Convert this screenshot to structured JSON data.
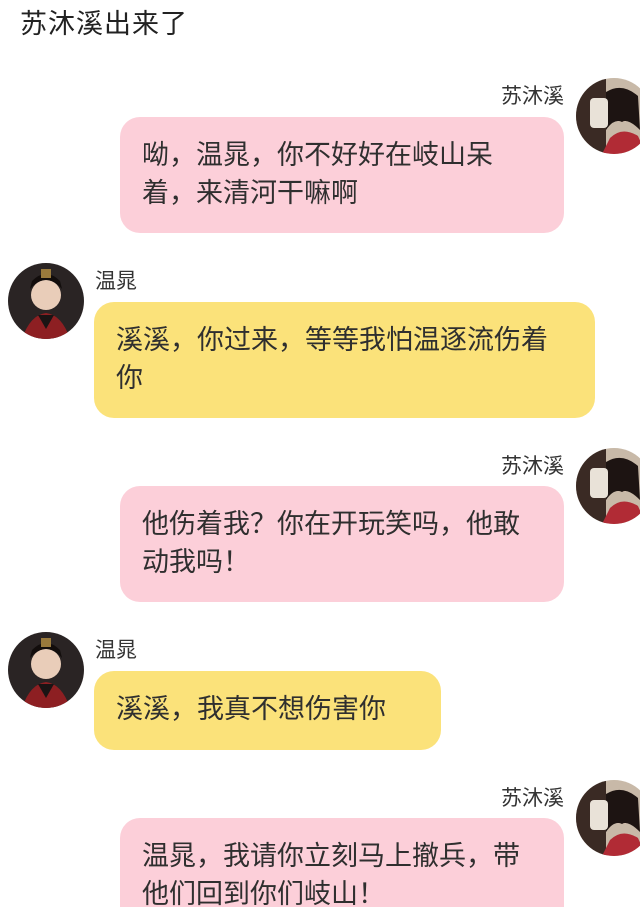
{
  "header": {
    "title": "苏沐溪出来了"
  },
  "colors": {
    "pink_bubble": "#fccfd9",
    "yellow_bubble": "#fbe27a"
  },
  "messages": [
    {
      "sender": "苏沐溪",
      "side": "right",
      "text": "呦，温晁，你不好好在岐山呆着，来清河干嘛啊"
    },
    {
      "sender": "温晁",
      "side": "left",
      "text": "溪溪，你过来，等等我怕温逐流伤着你"
    },
    {
      "sender": "苏沐溪",
      "side": "right",
      "text": "他伤着我？你在开玩笑吗，他敢动我吗！"
    },
    {
      "sender": "温晁",
      "side": "left",
      "text": "溪溪，我真不想伤害你"
    },
    {
      "sender": "苏沐溪",
      "side": "right",
      "text": "温晁，我请你立刻马上撤兵，带他们回到你们岐山！"
    }
  ]
}
